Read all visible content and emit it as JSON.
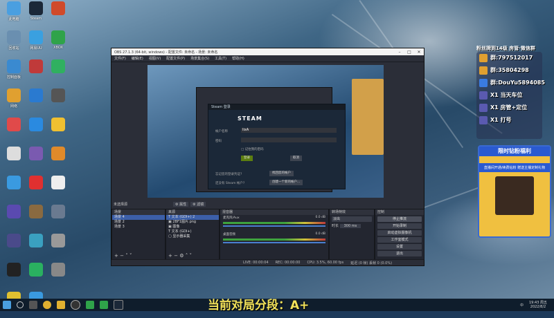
{
  "desktop_icons": [
    {
      "label": "此电脑",
      "color": "#4a9fe0"
    },
    {
      "label": "Steam",
      "color": "#1b2838"
    },
    {
      "label": "",
      "color": "#d04a2a"
    },
    {
      "label": "回收站",
      "color": "#6a8fb0"
    },
    {
      "label": "网易UU",
      "color": "#3aa0e0"
    },
    {
      "label": "XBOX",
      "color": "#2fa34a"
    },
    {
      "label": "控制面板",
      "color": "#3a8ad0"
    },
    {
      "label": "",
      "color": "#c03a3a"
    },
    {
      "label": "",
      "color": "#30b060"
    },
    {
      "label": "网络",
      "color": "#e0a030"
    },
    {
      "label": "",
      "color": "#2a7ad0"
    },
    {
      "label": "",
      "color": "#555"
    },
    {
      "label": "",
      "color": "#e04a4a"
    },
    {
      "label": "",
      "color": "#2a8ae0"
    },
    {
      "label": "",
      "color": "#f0c030"
    },
    {
      "label": "",
      "color": "#ddd"
    },
    {
      "label": "",
      "color": "#7a5ab0"
    },
    {
      "label": "",
      "color": "#e08a2a"
    },
    {
      "label": "",
      "color": "#3a9ae0"
    },
    {
      "label": "",
      "color": "#e03030"
    },
    {
      "label": "",
      "color": "#eee"
    },
    {
      "label": "",
      "color": "#5a4ab0"
    },
    {
      "label": "",
      "color": "#8a6a40"
    },
    {
      "label": "",
      "color": "#6a7a90"
    },
    {
      "label": "",
      "color": "#4a4a8a"
    },
    {
      "label": "",
      "color": "#3aa0c0"
    },
    {
      "label": "",
      "color": "#999"
    },
    {
      "label": "",
      "color": "#222"
    },
    {
      "label": "",
      "color": "#2ab060"
    },
    {
      "label": "",
      "color": "#888"
    },
    {
      "label": "",
      "color": "#e0c030"
    },
    {
      "label": "",
      "color": "#3a9ae0"
    }
  ],
  "obs": {
    "title": "OBS 27.1.3 (64-bit, windows) - 配置文件: 未命名 - 场景: 未命名",
    "menu": [
      "文件(F)",
      "编辑(E)",
      "视图(V)",
      "配置文件(P)",
      "场景集合(S)",
      "工具(T)",
      "帮助(H)"
    ],
    "no_source": "未选择源",
    "props": "属性",
    "filters": "滤镜",
    "scenes_hdr": "场景",
    "scenes": [
      "场景 4",
      "场景 2",
      "场景 3"
    ],
    "sources_hdr": "来源",
    "sources": [
      "文本 (GDI+) 2",
      "2BF1图片.png",
      "图像",
      "文本 (GDI+)",
      "显示器采集"
    ],
    "mixer_hdr": "混音器",
    "mixer": [
      {
        "name": "桌面音频",
        "level": "0.0 dB"
      },
      {
        "name": "麦克风/Aux",
        "level": "0.0 dB"
      }
    ],
    "trans_hdr": "转场特效",
    "trans_name": "淡出",
    "trans_dur_label": "时长",
    "trans_dur": "300 ms",
    "ctrl_hdr": "控制",
    "controls": [
      "停止推流",
      "开始录制",
      "启动虚拟摄像机",
      "工作室模式",
      "设置",
      "退出"
    ],
    "status": {
      "live": "LIVE: 00:00:04",
      "rec": "REC: 00:00:00",
      "cpu": "CPU: 3.5%, 60.00 fps",
      "dropped": "延迟 (0 帧) 丢帧 0 (0.0%)"
    }
  },
  "steam": {
    "title": "Steam 登录",
    "logo": "STEAM",
    "account_label": "帐户名称",
    "account_value": "lixA",
    "password_label": "密码",
    "remember": "记住我的密码",
    "login": "登录",
    "cancel": "取消",
    "forgot_text": "忘记您的登录凭证?",
    "forgot_btn": "找回您的帐户",
    "no_account": "还没有 Steam 帐户?",
    "create_btn": "创建一个新的帐户..."
  },
  "right_panel": {
    "header": "粉丝牌到14级 房管·微信群",
    "lines": [
      "群:797512017",
      "群:35804298",
      "群:DouYu5894085",
      "X1  当天车位",
      "X1  房管+定位",
      "X1  打号"
    ],
    "banner": "限时钻粉福利",
    "banner_sub": "直播间开通/续费钻粉 赠送主播定制礼物"
  },
  "taskbar": {
    "time": "19:43 周五",
    "date": "2022/8/2",
    "lang": "中",
    "icons": [
      "windows-icon",
      "search-icon",
      "task-view-icon",
      "chrome-icon",
      "folder-icon",
      "clock-icon",
      "xbox-icon",
      "xbox-icon",
      "steam-icon"
    ]
  },
  "subtitle": "当前对局分段：A+"
}
